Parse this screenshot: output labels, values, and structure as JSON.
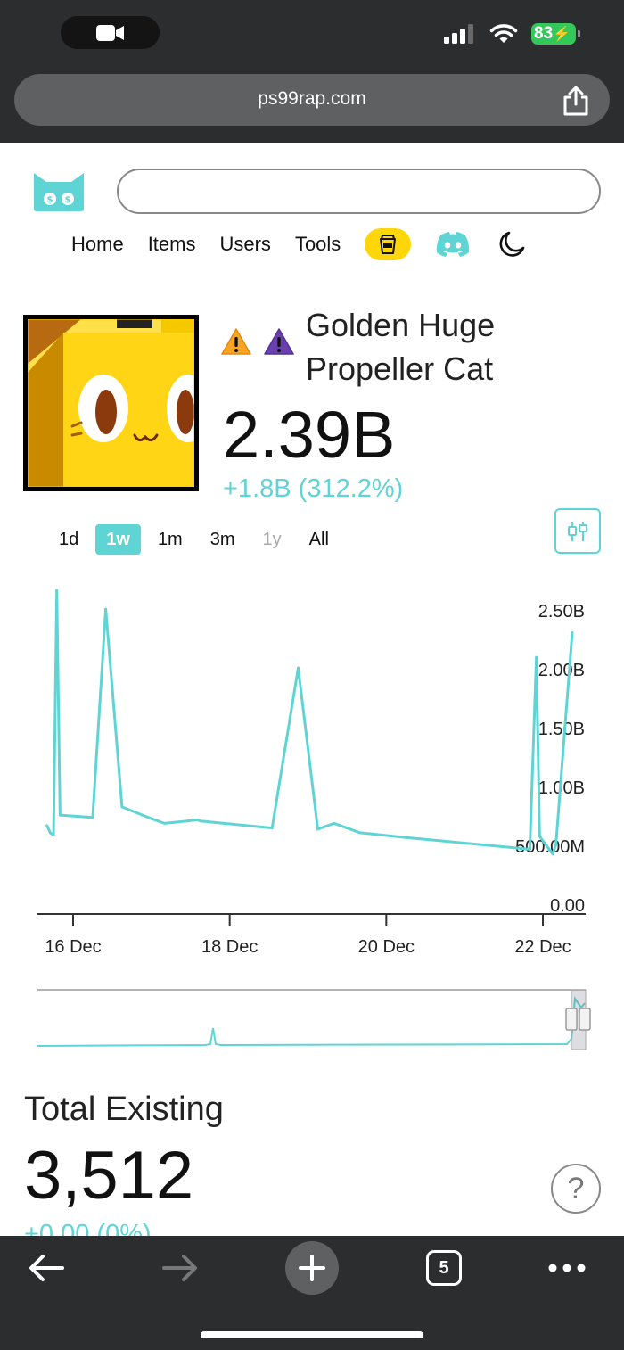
{
  "status_bar": {
    "battery": "83"
  },
  "browser": {
    "url": "ps99rap.com",
    "tab_count": "5"
  },
  "site": {
    "search_placeholder": "",
    "nav": [
      "Home",
      "Items",
      "Users",
      "Tools"
    ],
    "brand_color": "#5fd4d4",
    "coffee_color": "#ffd60a"
  },
  "item": {
    "name": "Golden Huge Propeller Cat",
    "price": "2.39B",
    "change": "+1.8B (312.2%)"
  },
  "time_ranges": [
    {
      "label": "1d",
      "state": "normal"
    },
    {
      "label": "1w",
      "state": "active"
    },
    {
      "label": "1m",
      "state": "normal"
    },
    {
      "label": "3m",
      "state": "normal"
    },
    {
      "label": "1y",
      "state": "disabled"
    },
    {
      "label": "All",
      "state": "normal"
    }
  ],
  "chart_data": {
    "type": "line",
    "title": "",
    "xlabel": "",
    "ylabel": "",
    "x_ticks": [
      "16 Dec",
      "18 Dec",
      "20 Dec",
      "22 Dec"
    ],
    "y_ticks": [
      "0.00",
      "500.00M",
      "1.00B",
      "1.50B",
      "2.00B",
      "2.50B"
    ],
    "ylim": [
      0,
      2.5
    ],
    "series": [
      {
        "color": "#5fd4d4",
        "x": [
          "15 Dec 16:00",
          "15 Dec 17:00",
          "15 Dec 18:00",
          "15 Dec 19:00",
          "15 Dec 20:00",
          "16 Dec 06:00",
          "16 Dec 10:00",
          "16 Dec 15:00",
          "17 Dec 00:00",
          "17 Dec 04:00",
          "17 Dec 11:00",
          "17 Dec 14:00",
          "17 Dec 15:00",
          "18 Dec 13:00",
          "18 Dec 21:00",
          "19 Dec 03:00",
          "19 Dec 08:00",
          "19 Dec 16:00",
          "20 Dec 06:00",
          "21 Dec 20:00",
          "21 Dec 22:00",
          "21 Dec 23:00",
          "22 Dec 03:00",
          "22 Dec 04:00",
          "22 Dec 09:00"
        ],
        "values": [
          0.75,
          0.69,
          0.67,
          2.75,
          0.84,
          0.82,
          2.59,
          0.91,
          0.81,
          0.77,
          0.79,
          0.8,
          0.79,
          0.73,
          2.09,
          0.72,
          0.77,
          0.69,
          0.65,
          0.55,
          2.18,
          0.66,
          0.51,
          0.59,
          2.39
        ]
      }
    ],
    "grid": false,
    "navigator": true
  },
  "stats": {
    "total_label": "Total Existing",
    "total_value": "3,512",
    "total_change": "+0.00 (0%)"
  }
}
